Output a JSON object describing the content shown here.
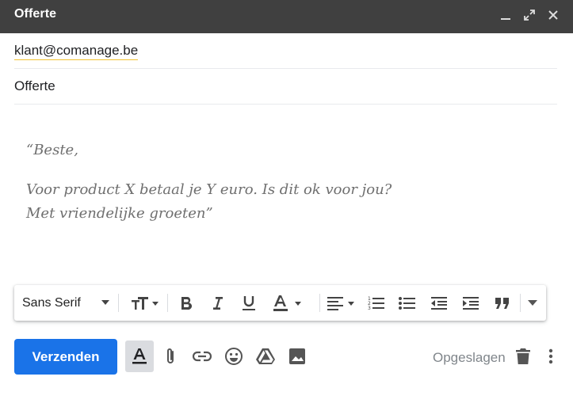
{
  "window": {
    "title": "Offerte",
    "controls": [
      "minimize-icon",
      "expand-icon",
      "close-icon"
    ]
  },
  "to": {
    "recipient": "klant@comanage.be"
  },
  "subject": {
    "value": "Offerte"
  },
  "body": {
    "greeting": "“Beste,",
    "line1": "Voor product X betaal je Y euro. Is dit ok voor jou?",
    "line2": "Met vriendelijke groeten”"
  },
  "formatting": {
    "font": "Sans Serif",
    "tools": [
      "text-size-icon",
      "bold-icon",
      "italic-icon",
      "underline-icon",
      "text-color-icon",
      "align-icon",
      "numbered-list-icon",
      "bulleted-list-icon",
      "indent-less-icon",
      "indent-more-icon",
      "quote-icon",
      "more-formatting-icon"
    ]
  },
  "bottom": {
    "send_label": "Verzenden",
    "saved_label": "Opgeslagen",
    "tools": [
      "formatting-options-icon",
      "attach-icon",
      "link-icon",
      "emoji-icon",
      "drive-icon",
      "photo-icon",
      "discard-icon",
      "more-options-icon"
    ]
  },
  "colors": {
    "titlebar": "#404040",
    "send": "#1a73e8",
    "muted": "#80868b"
  }
}
